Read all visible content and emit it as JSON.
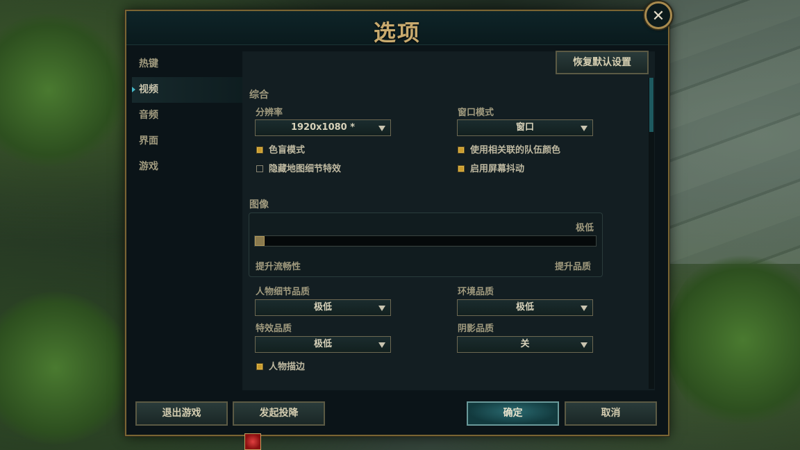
{
  "window": {
    "title": "选项"
  },
  "sidebar": {
    "items": [
      {
        "label": "热键",
        "active": false
      },
      {
        "label": "视频",
        "active": true
      },
      {
        "label": "音频",
        "active": false
      },
      {
        "label": "界面",
        "active": false
      },
      {
        "label": "游戏",
        "active": false
      }
    ]
  },
  "toolbar": {
    "restore_defaults": "恢复默认设置"
  },
  "general": {
    "section_label": "综合",
    "resolution": {
      "label": "分辨率",
      "value": "1920x1080 *"
    },
    "window_mode": {
      "label": "窗口模式",
      "value": "窗口"
    },
    "checkboxes": {
      "colorblind": {
        "label": "色盲模式",
        "checked": true
      },
      "team_colors": {
        "label": "使用相关联的队伍颜色",
        "checked": true
      },
      "hide_map_detail": {
        "label": "隐藏地图细节特效",
        "checked": false
      },
      "screen_shake": {
        "label": "启用屏幕抖动",
        "checked": true
      }
    }
  },
  "graphics": {
    "section_label": "图像",
    "preset_value": "极低",
    "slider_level": 0,
    "left_label": "提升流畅性",
    "right_label": "提升品质",
    "character_quality": {
      "label": "人物细节品质",
      "value": "极低"
    },
    "environment_quality": {
      "label": "环境品质",
      "value": "极低"
    },
    "effects_quality": {
      "label": "特效品质",
      "value": "极低"
    },
    "shadow_quality": {
      "label": "阴影品质",
      "value": "关"
    },
    "character_outline": {
      "label": "人物描边",
      "checked": true
    }
  },
  "footer": {
    "exit_game": "退出游戏",
    "surrender": "发起投降",
    "ok": "确定",
    "cancel": "取消"
  },
  "close_glyph": "✕",
  "colors": {
    "accent_gold": "#c8aa6e",
    "accent_teal": "#46b8c8"
  }
}
